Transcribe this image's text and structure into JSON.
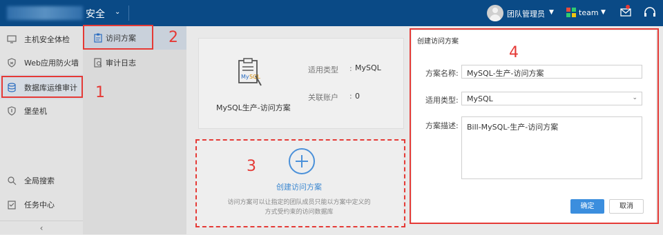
{
  "header": {
    "product": "安全",
    "user": "团队管理员",
    "team": "team",
    "colors": {
      "bar": "#0a4a86",
      "accent": "#3b8ede",
      "annotation": "#e53935"
    }
  },
  "sidebar": {
    "items": [
      {
        "label": "主机安全体检",
        "icon": "monitor-icon"
      },
      {
        "label": "Web应用防火墙",
        "icon": "shield-bug-icon"
      },
      {
        "label": "数据库运维审计",
        "icon": "database-icon"
      },
      {
        "label": "堡垒机",
        "icon": "shield-icon"
      }
    ],
    "bottom": [
      {
        "label": "全局搜索",
        "icon": "search-icon"
      },
      {
        "label": "任务中心",
        "icon": "checklist-icon"
      }
    ]
  },
  "subnav": {
    "items": [
      {
        "label": "访问方案",
        "icon": "clipboard-icon"
      },
      {
        "label": "审计日志",
        "icon": "log-icon"
      }
    ]
  },
  "card": {
    "name": "MySQL生产-访问方案",
    "type_label": "适用类型",
    "type_value": "MySQL",
    "accounts_label": "关联账户",
    "accounts_value": "0",
    "colon": ":"
  },
  "create": {
    "title": "创建访问方案",
    "desc_line1": "访问方案可以让指定的团队成员只能以方案中定义的",
    "desc_line2": "方式受约束的访问数据库"
  },
  "dialog": {
    "title": "创建访问方案",
    "name_label": "方案名称:",
    "name_value": "MySQL-生产-访问方案",
    "type_label": "适用类型:",
    "type_value": "MySQL",
    "desc_label": "方案描述:",
    "desc_value": "Bill-MySQL-生产-访问方案",
    "ok": "确定",
    "cancel": "取消"
  },
  "annotations": {
    "n1": "1",
    "n2": "2",
    "n3": "3",
    "n4": "4"
  }
}
